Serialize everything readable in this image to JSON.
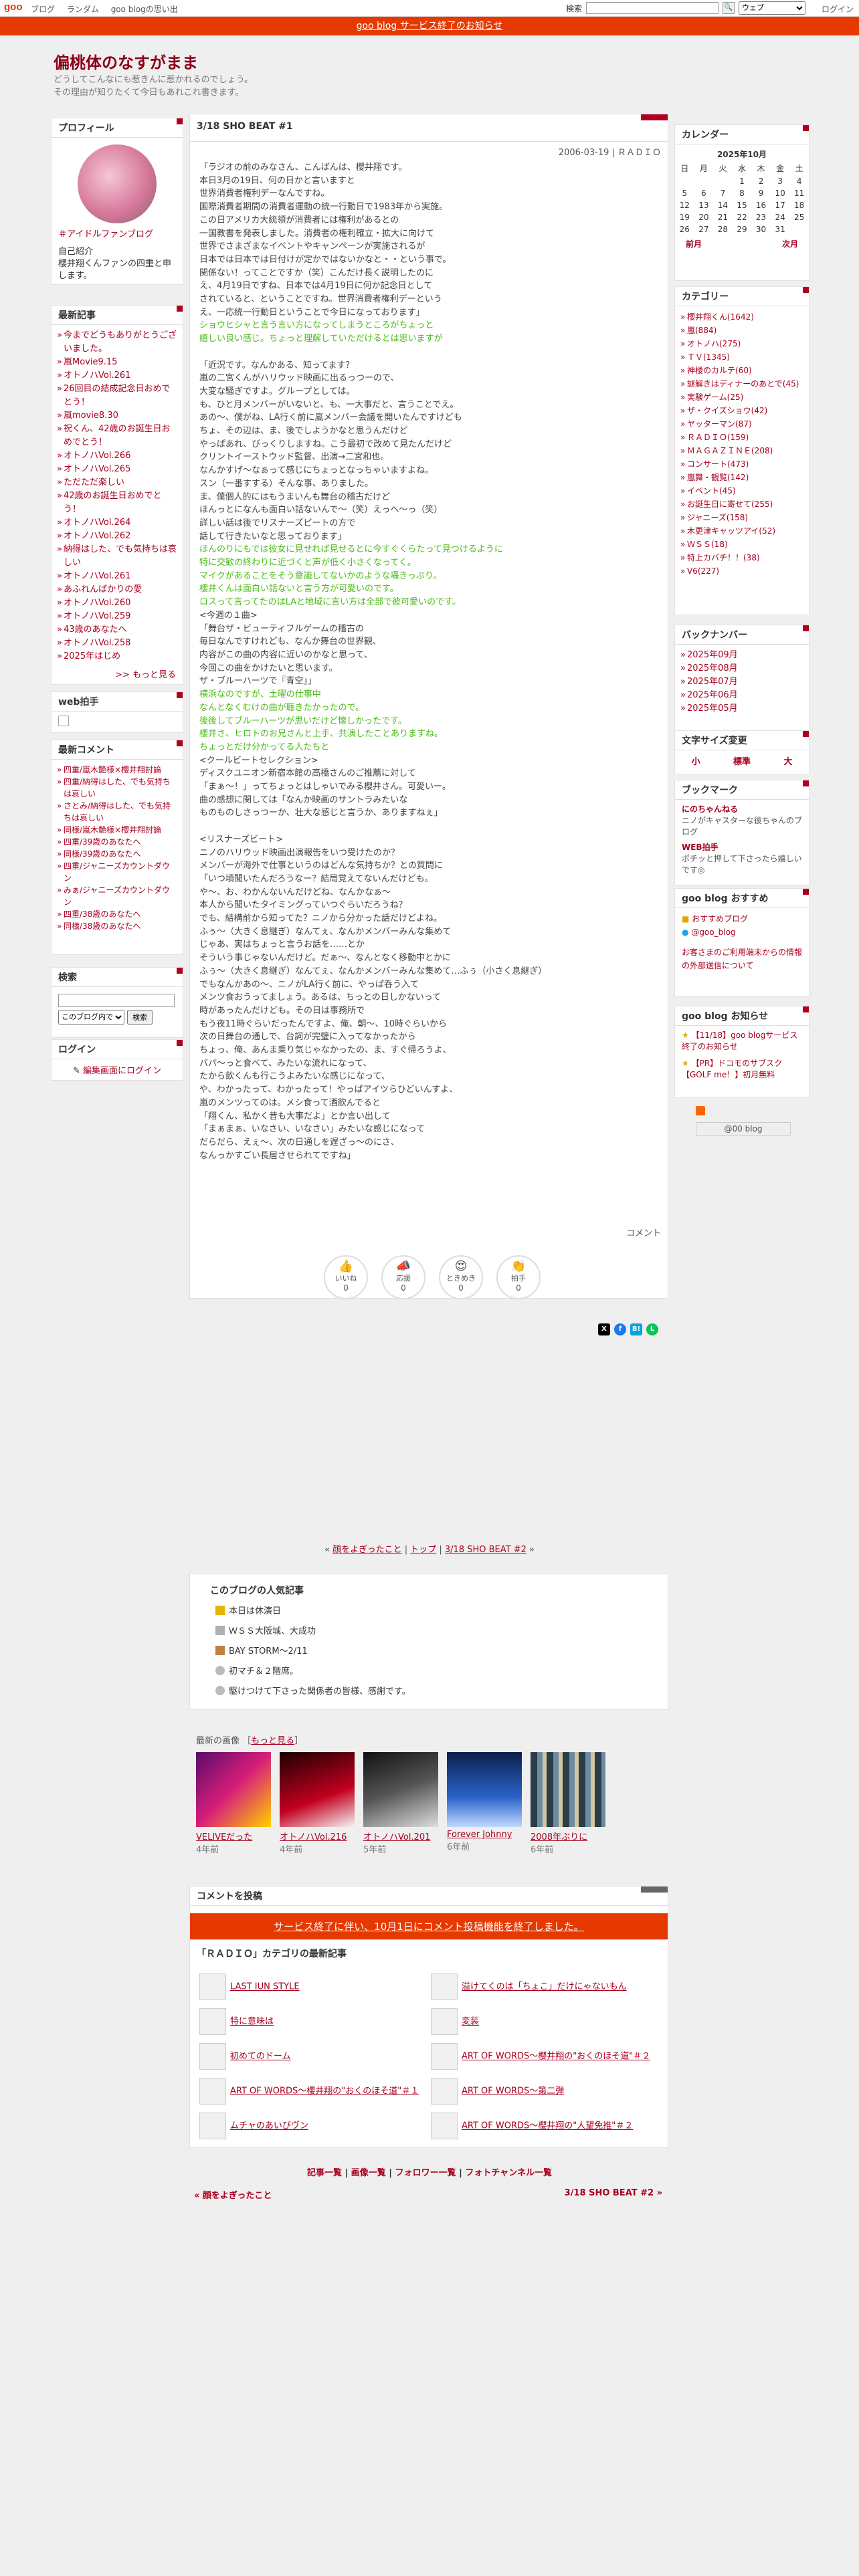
{
  "topbar": {
    "logo": "goo",
    "nav": [
      "ブログ",
      "ランダム",
      "goo blogの思い出"
    ],
    "search_label": "検索",
    "search_select": "ウェブ",
    "login": "ログイン"
  },
  "notice": "goo blog サービス終了のお知らせ",
  "blog": {
    "title": "偏桃体のなすがまま",
    "subtitle_1": "どうしてこんなにも惹きんに惹かれるのでしょう。",
    "subtitle_2": "その理由が知りたくて今日もあれこれ書きます。"
  },
  "profile": {
    "head": "プロフィール",
    "link": "＃アイドルファンブログ",
    "intro_head": "自己紹介",
    "intro": "櫻井翔くんファンの四重と申します。"
  },
  "recent": {
    "head": "最新記事",
    "items": [
      "今までどうもありがとうございました。",
      "嵐Movie9.15",
      "オトノハVol.261",
      "26回目の結成記念日おめでとう！",
      "嵐movie8.30",
      "祝くん、42歳のお誕生日おめでとう！",
      "オトノハVol.266",
      "オトノハVol.265",
      "ただただ楽しい",
      "42歳のお誕生日おめでとう！",
      "オトノハVol.264",
      "オトノハVol.262",
      "納得はした、でも気持ちは哀しい",
      "オトノハVol.261",
      "あふれんばかりの愛",
      "オトノハVol.260",
      "オトノハVol.259",
      "43歳のあなたへ",
      "オトノハVol.258",
      "2025年はじめ"
    ],
    "more": ">> もっと見る"
  },
  "webclap": {
    "head": "web拍手"
  },
  "comments_side": {
    "head": "最新コメント",
    "items": [
      "四重/嵐木艶様×櫻井翔討論",
      "四重/納得はした、でも気持ちは哀しい",
      "さとみ/納得はした、でも気持ちは哀しい",
      "同様/嵐木艶様×櫻井翔討論",
      "四重/39歳のあなたへ",
      "同様/39歳のあなたへ",
      "四重/ジャニーズカウントダウン",
      "みぁ/ジャニーズカウントダウン",
      "四重/38歳のあなたへ",
      "同様/38歳のあなたへ"
    ]
  },
  "search_side": {
    "head": "検索",
    "select": "このブログ内で",
    "button": "検索"
  },
  "login_side": {
    "head": "ログイン",
    "link": "編集画面にログイン"
  },
  "post": {
    "title": "3/18 SHO BEAT #1",
    "date": "2006-03-19 | ＲＡＤＩＯ",
    "lines": [
      {
        "t": "「ラジオの前のみなさん、こんばんは、櫻井翔です。"
      },
      {
        "t": "本日3月の19日、何の日かと言いますと"
      },
      {
        "t": "世界消費者権利デーなんですね。"
      },
      {
        "t": "国際消費者期間の消費者運動の統一行動日で1983年から実施。"
      },
      {
        "t": "この日アメリカ大統領が消費者には権利があるとの"
      },
      {
        "t": "一国教書を発表しました。消費者の権利確立・拡大に向けて"
      },
      {
        "t": "世界でさまざまなイベントやキャンペーンが実施されるが"
      },
      {
        "t": "日本では日本では日付けが定かではないかなと・・という事で。"
      },
      {
        "t": "関係ない！ってことですか（笑）こんだけ長く説明したのに"
      },
      {
        "t": "え、4月19日ですね、日本では4月19日に何か記念日として"
      },
      {
        "t": "されていると、ということですね。世界消費者権利デーという"
      },
      {
        "t": "え、一応統一行動日ということで今日になっております」"
      },
      {
        "t": "ショウヒシャと言う言い方になってしまうところがちょっと",
        "g": true
      },
      {
        "t": "嬉しい良い感じ。ちょっと理解していただけるとは思いますが",
        "g": true
      },
      {
        "t": ""
      },
      {
        "t": "「近況です。なんかある、知ってます？"
      },
      {
        "t": "嵐の二宮くんがハリウッド映画に出るっつーので、"
      },
      {
        "t": "大変な騒ぎですよ。グループとしては。"
      },
      {
        "t": "も、ひと月メンバーがいないと、も、一大事だと、言うことでえ。"
      },
      {
        "t": "あの～、僕がね、LA行く前に嵐メンバー会議を開いたんですけども"
      },
      {
        "t": "ちょ、その辺は、ま、後でしようかなと思うんだけど"
      },
      {
        "t": "やっぱあれ、びっくりしますね。こう最初で改めて見たんだけど"
      },
      {
        "t": "クリントイーストウッド監督、出演→二宮和也。"
      },
      {
        "t": "なんかすげ～なぁって感じにちょっとなっちゃいますよね。"
      },
      {
        "t": "スン（一番すする）そんな事、ありました。"
      },
      {
        "t": "ま、僕個人的にはもうまいんも舞台の稽古だけど"
      },
      {
        "t": "ほんっとになんも面白い話ないんで～（笑）えっへ～っ（笑）"
      },
      {
        "t": "詳しい話は後でリスナーズピートの方で"
      },
      {
        "t": "話して行きたいなと思っております」"
      },
      {
        "t": "ほんのりにもでは彼女に見せれば見せるとに今すぐくらたって見つけるように",
        "g": true
      },
      {
        "t": "特に交歓の終わりに近づくと声が低く小さくなってく。",
        "g": true
      },
      {
        "t": "マイクがあることをそう意識してないかのような囁きっぷり。",
        "g": true
      },
      {
        "t": "櫻井くんは面白い話ないと言う方が可愛いのです。",
        "g": true
      },
      {
        "t": "ロスって言ってたのはLAと地域に言い方は全部で彼可愛いのです。",
        "g": true
      },
      {
        "t": "<今週の１曲>"
      },
      {
        "t": "「舞台ザ・ビューティフルゲームの稽古の"
      },
      {
        "t": "毎日なんですけれども、なんか舞台の世界観、"
      },
      {
        "t": "内容がこの曲の内容に近いのかなと思って、"
      },
      {
        "t": "今回この曲をかけたいと思います。"
      },
      {
        "t": "ザ・ブルーハーツで『青空』」"
      },
      {
        "t": "横浜なのですが、土曜の仕事中",
        "g": true
      },
      {
        "t": "なんとなくむけの曲が聴きたかったので。",
        "g": true
      },
      {
        "t": "後後してブルーハーツが思いだけど懐しかったです。",
        "g": true
      },
      {
        "t": "櫻井さ、ヒロトのお兄さんと上手、共演したことありますね。",
        "g": true
      },
      {
        "t": "ちょっとだけ分かってる人たちと",
        "g": true
      },
      {
        "t": "<クールビートセレクション>"
      },
      {
        "t": "ディスクユニオン新宿本館の高橋さんのご推薦に対して"
      },
      {
        "t": "「まぁ～！」ってちょっとはしゃいでみる櫻井さん。可愛いー。"
      },
      {
        "t": "曲の感想に関しては「なんか映画のサントラみたいな"
      },
      {
        "t": "ものものしさっつーか、壮大な感じと言うか、ありますねぇ」"
      },
      {
        "t": ""
      },
      {
        "t": "<リスナーズビート>"
      },
      {
        "t": "ニノのハリウッド映画出演報告をいつ受けたのか？"
      },
      {
        "t": "メンバーが海外で仕事というのはどんな気持ちか？との質問に"
      },
      {
        "t": "「いつ頃聞いたんだろうなー？結局覚えてないんだけども。"
      },
      {
        "t": "や～、お、わかんないんだけどね、なんかなぁ～"
      },
      {
        "t": "本人から聞いたタイミングっていつぐらいだろうね？"
      },
      {
        "t": "でも、結構前から知ってた？ニノから分かった話だけどよね。"
      },
      {
        "t": "ふぅ～（大きく息継ぎ）なんてぇ、なんかメンバーみんな集めて"
      },
      {
        "t": "じゃあ、実はちょっと言うお話を……とか"
      },
      {
        "t": "そういう事じゃないんだけど。だぁ～、なんとなく移動中とかに"
      },
      {
        "t": "ふぅ～（大きく息継ぎ）なんてぇ、なんかメンバーみんな集めて…ふぅ（小さく息継ぎ）"
      },
      {
        "t": "でもなんかあの～、ニノがLA行く前に、やっぱ呑う入て"
      },
      {
        "t": "メンツ食おうってましょう。あるは、ちっとの日しかないって"
      },
      {
        "t": "時があったんだけども。その日は事務所で"
      },
      {
        "t": "もう夜11時ぐらいだったんですよ、俺、朝～、10時ぐらいから"
      },
      {
        "t": "次の日舞台の通しで、台詞が完璧に入ってなかったから"
      },
      {
        "t": "ちょっ、俺、あんま乗り気じゃなかったの、ま、すぐ帰ろうよ、"
      },
      {
        "t": "バパ～っと食べて、みたいな流れになって、"
      },
      {
        "t": "たから飲くんも行こうよみたいな感じになって、"
      },
      {
        "t": "や、わかったって、わかったって！やっぱアイツらひどいんすよ、"
      },
      {
        "t": "嵐のメンツってのは。メシ食って酒飲んでると"
      },
      {
        "t": "「翔くん、私かく昔も大事だよ」とか言い出して"
      },
      {
        "t": "「まぁまぁ、いなさい、いなさい」みたいな感じになって"
      },
      {
        "t": "だらだら、えぇ～、次の日通しを遅ざっ～のにさ、"
      },
      {
        "t": "なんっかすごい長居させられてですね」"
      }
    ],
    "comment_link": "コメント",
    "reactions": [
      {
        "icon": "👍",
        "label": "いいね",
        "count": "0"
      },
      {
        "icon": "📣",
        "label": "応援",
        "count": "0"
      },
      {
        "icon": "😍",
        "label": "ときめき",
        "count": "0"
      },
      {
        "icon": "👏",
        "label": "拍手",
        "count": "0"
      }
    ]
  },
  "pager": {
    "prev": "顔をよぎったこと",
    "top": "トップ",
    "next": "3/18 SHO BEAT #2"
  },
  "popular": {
    "head": "このブログの人気記事",
    "items": [
      "本日は休演日",
      "ＷＳＳ大阪城、大成功",
      "BAY STORM～2/11",
      "初マチ＆２階席。",
      "駆けつけて下さった関係者の皆様、感謝です。"
    ]
  },
  "images": {
    "head": "最新の画像",
    "more": "もっと見る",
    "items": [
      {
        "caption": "VELIVEだった",
        "age": "4年前"
      },
      {
        "caption": "オトノハVol.216",
        "age": "4年前"
      },
      {
        "caption": "オトノハVol.201",
        "age": "5年前"
      },
      {
        "caption": "Forever Johnny",
        "age": "6年前"
      },
      {
        "caption": "2008年ぶりに",
        "age": "6年前"
      }
    ]
  },
  "comment_box": {
    "head": "コメントを投稿",
    "warn": "サービス終了に伴い、10月1日にコメント投稿機能を終了しました。"
  },
  "category": {
    "head": "「ＲＡＤＩＯ」カテゴリの最新記事",
    "left": [
      "LAST IUN STYLE",
      "特に意味は",
      "初めてのドーム",
      "ART OF WORDS～櫻井翔の\"おくのほそ道\"＃１",
      "ムチャのあいびヴン"
    ],
    "right": [
      "溢けてくのは「ちょこ」だけにゃないもん",
      "変装",
      "ART OF WORDS～櫻井翔の\"おくのほそ道\"＃２",
      "ART OF WORDS～第二弾",
      "ART OF WORDS～櫻井翔の\"人望免推\"＃２"
    ]
  },
  "footlinks": [
    "記事一覧",
    "画像一覧",
    "フォロワー一覧",
    "フォトチャンネル一覧"
  ],
  "footnav": {
    "prev": "« 顔をよぎったこと",
    "next": "3/18 SHO BEAT #2 »"
  },
  "calendar": {
    "head": "カレンダー",
    "month": "2025年10月",
    "days": [
      "日",
      "月",
      "火",
      "水",
      "木",
      "金",
      "土"
    ],
    "rows": [
      [
        "",
        "",
        "",
        "1",
        "2",
        "3",
        "4"
      ],
      [
        "5",
        "6",
        "7",
        "8",
        "9",
        "10",
        "11"
      ],
      [
        "12",
        "13",
        "14",
        "15",
        "16",
        "17",
        "18"
      ],
      [
        "19",
        "20",
        "21",
        "22",
        "23",
        "24",
        "25"
      ],
      [
        "26",
        "27",
        "28",
        "29",
        "30",
        "31",
        ""
      ]
    ],
    "prev": "前月",
    "next": "次月"
  },
  "categories": {
    "head": "カテゴリー",
    "items": [
      "櫻井翔くん(1642)",
      "嵐(884)",
      "オトノハ(275)",
      "ＴＶ(1345)",
      "神楼のカルテ(60)",
      "謎解きはディナーのあとで(45)",
      "実験ゲーム(25)",
      "ザ・クイズショウ(42)",
      "ヤッターマン(87)",
      "ＲＡＤＩＯ(159)",
      "ＭＡＧＡＺＩＮＥ(208)",
      "コンサート(473)",
      "嵐舞・観覧(142)",
      "イベント(45)",
      "お誕生日に寄せて(255)",
      "ジャニーズ(158)",
      "木更津キャッツアイ(52)",
      "ＷＳＳ(18)",
      "特上カバチ！！(38)",
      "V6(227)"
    ]
  },
  "backnumber": {
    "head": "バックナンバー",
    "items": [
      "2025年09月",
      "2025年08月",
      "2025年07月",
      "2025年06月",
      "2025年05月"
    ]
  },
  "fontsize": {
    "head": "文字サイズ変更",
    "small": "小",
    "normal": "標準",
    "large": "大"
  },
  "bookmark": {
    "head": "ブックマーク",
    "items": [
      {
        "name": "にのちゃんねる",
        "desc": "ニノがキャスターな彼ちゃんのブログ"
      },
      {
        "name": "WEB拍手",
        "desc": "ポチッと押して下さったら嬉しいです◎"
      }
    ]
  },
  "recommend": {
    "head": "goo blog おすすめ",
    "items": [
      "おすすめブログ",
      "@goo_blog"
    ],
    "note": "お客さまのご利用端末からの情報の外部送信について"
  },
  "oshirase": {
    "head": "goo blog お知らせ",
    "items": [
      "【11/18】goo blogサービス終了のお知らせ",
      "【PR】ドコモのサブスク【GOLF me！】初月無料"
    ]
  },
  "rss": {
    "label": "@00 blog"
  }
}
